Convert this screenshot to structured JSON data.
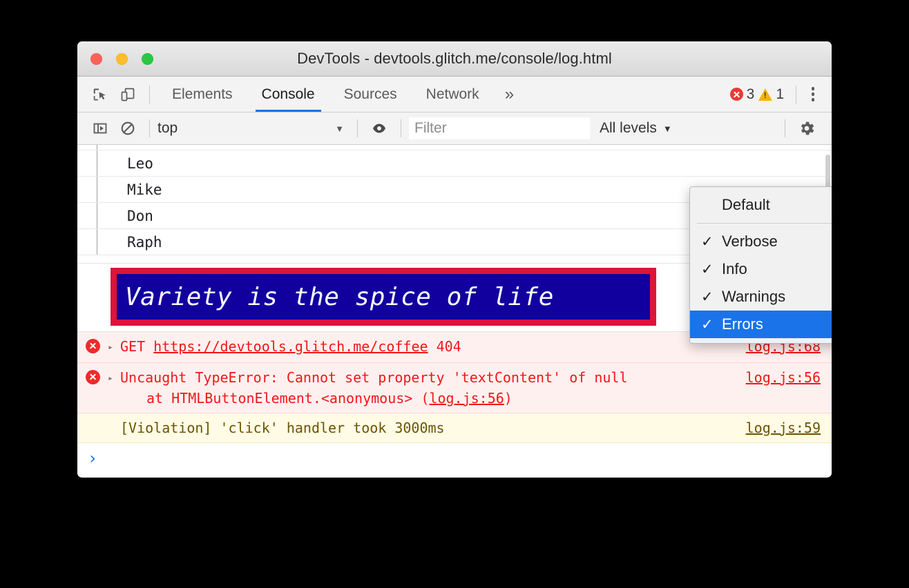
{
  "window": {
    "title": "DevTools - devtools.glitch.me/console/log.html",
    "traffic_lights": {
      "close": "close-button",
      "minimize": "minimize-button",
      "maximize": "maximize-button"
    }
  },
  "tabbar": {
    "inspect_icon": "inspect-element-icon",
    "device_icon": "device-toolbar-icon",
    "tabs": [
      {
        "label": "Elements",
        "active": false
      },
      {
        "label": "Console",
        "active": true
      },
      {
        "label": "Sources",
        "active": false
      },
      {
        "label": "Network",
        "active": false
      }
    ],
    "overflow_label": "»",
    "error_count": "3",
    "warning_count": "1",
    "menu_icon": "more-options-icon"
  },
  "filterbar": {
    "sidebar_icon": "show-console-sidebar-icon",
    "clear_icon": "clear-console-icon",
    "context": "top",
    "context_caret": "▼",
    "eye_icon": "live-expressions-icon",
    "filter_placeholder": "Filter",
    "filter_value": "",
    "levels_label": "All levels",
    "levels_caret": "▼",
    "settings_icon": "settings-gear-icon"
  },
  "levels_menu": {
    "items": [
      {
        "label": "Default",
        "checked": false,
        "selected": false
      },
      {
        "label": "Verbose",
        "checked": true,
        "selected": false
      },
      {
        "label": "Info",
        "checked": true,
        "selected": false
      },
      {
        "label": "Warnings",
        "checked": true,
        "selected": false
      },
      {
        "label": "Errors",
        "checked": true,
        "selected": true
      }
    ],
    "check_glyph": "✓",
    "separator_after_index": 0
  },
  "console": {
    "table_rows": [
      {
        "value": ""
      },
      {
        "value": "Leo"
      },
      {
        "value": "Mike"
      },
      {
        "value": "Don"
      },
      {
        "value": "Raph"
      }
    ],
    "styled_message": {
      "text": "Variety is the spice of life",
      "background_color": "#11009E",
      "border_color": "#DC143C",
      "text_color": "#FFFFFF"
    },
    "messages": [
      {
        "level": "error",
        "icon": "error-icon",
        "disclosure": "▸",
        "method": "GET",
        "url": "https://devtools.glitch.me/coffee",
        "status": "404",
        "text": "GET https://devtools.glitch.me/coffee 404",
        "source": "log.js:68"
      },
      {
        "level": "error",
        "icon": "error-icon",
        "disclosure": "▸",
        "text": "Uncaught TypeError: Cannot set property 'textContent' of null",
        "stack": "at HTMLButtonElement.<anonymous> (",
        "stack_link": "log.js:56",
        "stack_tail": ")",
        "source": "log.js:56"
      },
      {
        "level": "warning",
        "icon": "",
        "text": "[Violation] 'click' handler took 3000ms",
        "source": "log.js:59"
      }
    ],
    "prompt_chevron": "›"
  }
}
